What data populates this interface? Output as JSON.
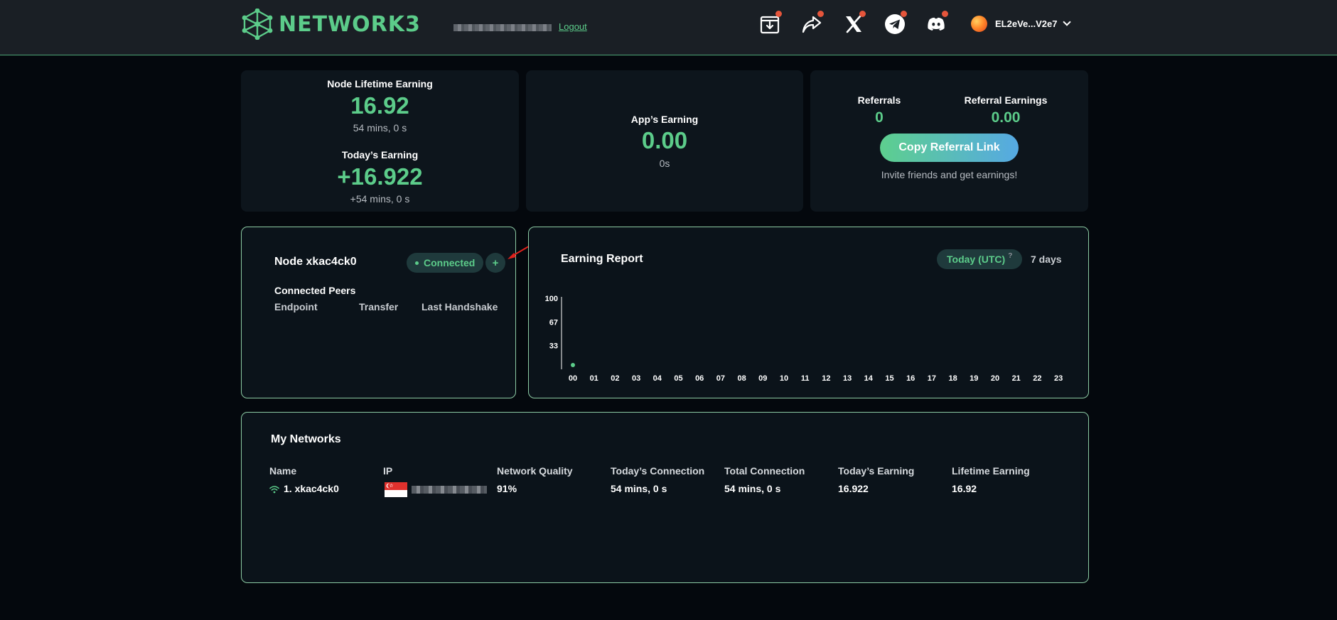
{
  "header": {
    "logo_text": "NETWORK3",
    "logout_label": "Logout",
    "icons": [
      "download-icon",
      "share-icon",
      "x-icon",
      "telegram-icon",
      "discord-icon"
    ],
    "wallet_address": "EL2eVe...V2e7"
  },
  "stats": {
    "node_lifetime": {
      "label": "Node Lifetime Earning",
      "value": "16.92",
      "duration": "54 mins, 0 s"
    },
    "today": {
      "label": "Today’s Earning",
      "value": "+16.922",
      "duration": "+54 mins, 0 s"
    },
    "app": {
      "label": "App’s Earning",
      "value": "0.00",
      "duration": "0s"
    },
    "referrals": {
      "referrals_label": "Referrals",
      "referrals_value": "0",
      "earnings_label": "Referral Earnings",
      "earnings_value": "0.00",
      "copy_button": "Copy Referral Link",
      "invite_text": "Invite friends and get earnings!"
    }
  },
  "node": {
    "title": "Node xkac4ck0",
    "status": "Connected",
    "plus_label": "+",
    "peers_title": "Connected Peers",
    "columns": [
      "Endpoint",
      "Transfer",
      "Last Handshake"
    ]
  },
  "earning_report": {
    "title": "Earning Report",
    "tab_today": "Today (UTC)",
    "tab_today_help": "?",
    "tab_7days": "7 days"
  },
  "chart_data": {
    "type": "line",
    "title": "",
    "xlabel": "",
    "ylabel": "",
    "y_ticks": [
      "100",
      "67",
      "33"
    ],
    "ylim": [
      0,
      100
    ],
    "categories": [
      "00",
      "01",
      "02",
      "03",
      "04",
      "05",
      "06",
      "07",
      "08",
      "09",
      "10",
      "11",
      "12",
      "13",
      "14",
      "15",
      "16",
      "17",
      "18",
      "19",
      "20",
      "21",
      "22",
      "23"
    ],
    "series": [
      {
        "values": [
          0
        ]
      }
    ],
    "color": "#5ccc8a"
  },
  "networks": {
    "title": "My Networks",
    "columns": [
      "Name",
      "IP",
      "Network Quality",
      "Today’s Connection",
      "Total Connection",
      "Today’s Earning",
      "Lifetime Earning"
    ],
    "rows": [
      {
        "name": "1. xkac4ck0",
        "quality": "91%",
        "today_connection": "54 mins, 0 s",
        "total_connection": "54 mins, 0 s",
        "today_earning": "16.922",
        "lifetime_earning": "16.92"
      }
    ]
  }
}
